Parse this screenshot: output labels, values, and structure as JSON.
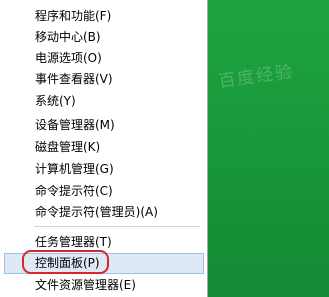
{
  "menu": {
    "items": [
      {
        "label": "程序和功能(F)"
      },
      {
        "label": "移动中心(B)"
      },
      {
        "label": "电源选项(O)"
      },
      {
        "label": "事件查看器(V)"
      },
      {
        "label": "系统(Y)"
      },
      {
        "label": "设备管理器(M)"
      },
      {
        "label": "磁盘管理(K)"
      },
      {
        "label": "计算机管理(G)"
      },
      {
        "label": "命令提示符(C)"
      },
      {
        "label": "命令提示符(管理员)(A)"
      },
      {
        "label": "任务管理器(T)"
      },
      {
        "label": "控制面板(P)"
      },
      {
        "label": "文件资源管理器(E)"
      }
    ],
    "selected_label": "控制面板(P)"
  },
  "colors": {
    "desktop_green": "#1c9b3c",
    "selection_fill": "#dfe9f6",
    "selection_border": "#9ec0e6",
    "annotation_ring": "#d9262a"
  },
  "watermark": {
    "text": "百度经验"
  }
}
